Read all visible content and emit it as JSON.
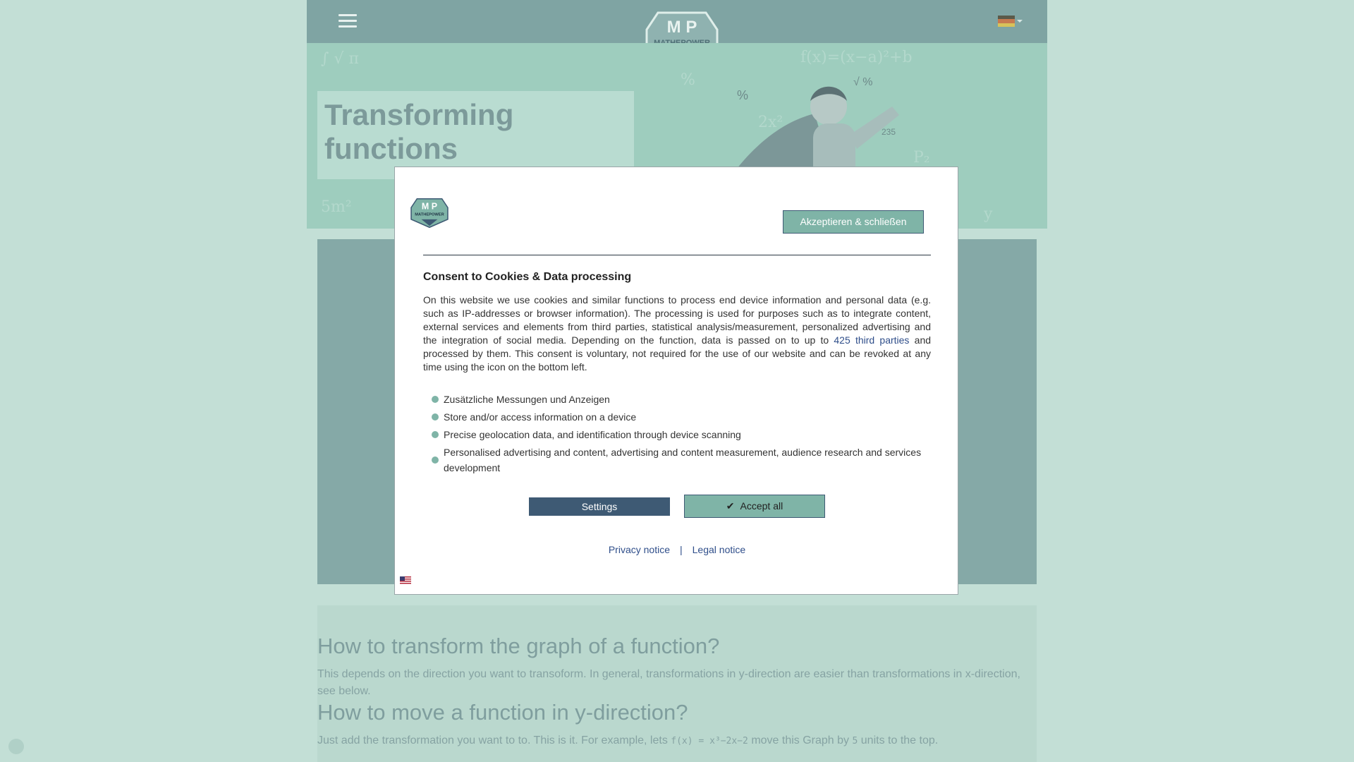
{
  "header": {
    "logo_text_letters": "M P",
    "logo_subtext": "MATHEPOWER",
    "language_flag": "flag-de-icon"
  },
  "hero": {
    "title": "Transforming functions"
  },
  "content": {
    "heading_1": "How to transform the graph of a function?",
    "paragraph_1": "This depends on the direction you want to transoform. In general, transformations in y-direction are easier than transformations in x-direction, see below.",
    "heading_2": "How to move a function in y-direction?",
    "paragraph_2_prefix": "Just add the transformation you want to to. This is it. For example, lets",
    "paragraph_2_math": "f(x) = x³−2x−2",
    "paragraph_2_suffix": "move this Graph by",
    "paragraph_2_number": "5",
    "paragraph_2_end": "units to the top."
  },
  "consent": {
    "accept_close_label": "Akzeptieren & schließen",
    "title": "Consent to Cookies & Data processing",
    "text_before_link": "On this website we use cookies and similar functions to process end device information and personal data (e.g. such as IP-addresses or browser information). The processing is used for purposes such as to integrate content, external services and elements from third parties, statistical analysis/measurement, personalized advertising and the integration of social media. Depending on the function, data is passed on to up to",
    "link_text": "425 third parties",
    "text_after_link": "and processed by them. This consent is voluntary, not required for the use of our website and can be revoked at any time using the icon on the bottom left.",
    "purposes": [
      "Zusätzliche Messungen und Anzeigen",
      "Store and/or access information on a device",
      "Precise geolocation data, and identification through device scanning",
      "Personalised advertising and content, advertising and content measurement, audience research and services development"
    ],
    "settings_label": "Settings",
    "accept_all_label": "Accept all",
    "privacy_label": "Privacy notice",
    "separator": "|",
    "legal_label": "Legal notice"
  },
  "colors": {
    "page_bg": "#c3dfd6",
    "topbar": "#7fa4a3",
    "accent_green": "#7fb4a7",
    "navy": "#3e5a74",
    "link": "#2f4e8a"
  }
}
